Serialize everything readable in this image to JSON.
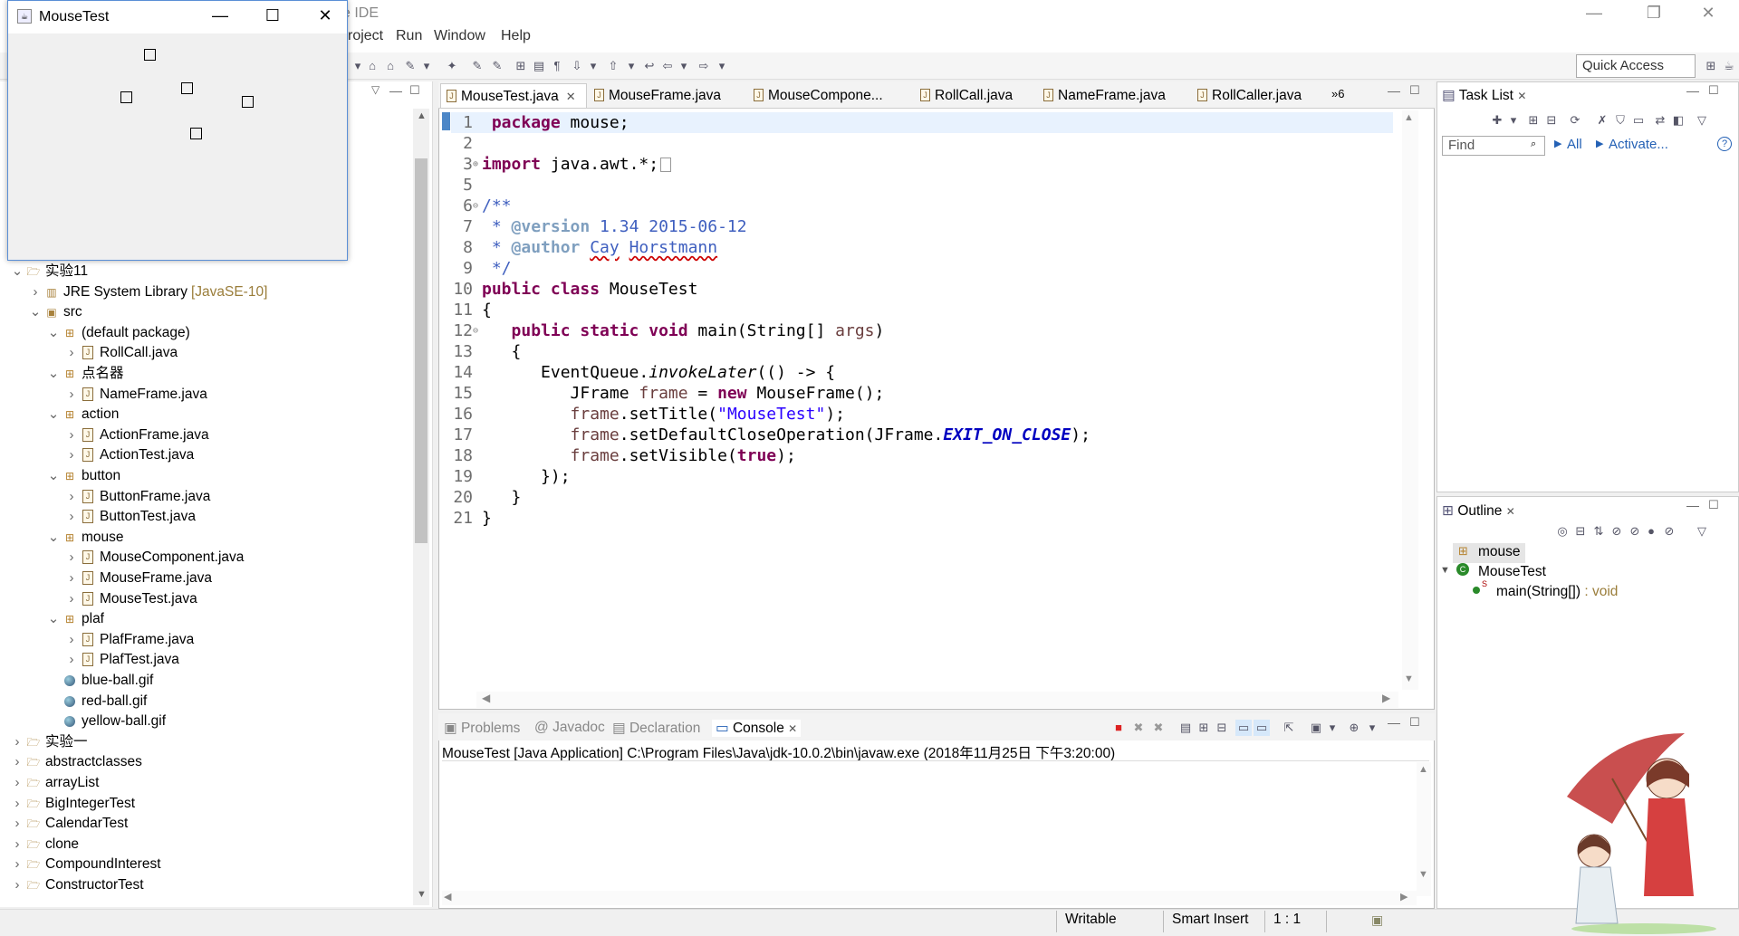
{
  "ide": {
    "title": "e IDE",
    "menus": [
      "roject",
      "Run",
      "Window",
      "Help"
    ],
    "quick_access": "Quick Access"
  },
  "mouse_window": {
    "title": "MouseTest",
    "minimize": "—",
    "maximize": "☐",
    "close": "✕"
  },
  "explorer": {
    "items": [
      {
        "label": "实验11",
        "kind": "project",
        "arrow": "v"
      },
      {
        "label": "JRE System Library",
        "suffix": "[JavaSE-10]",
        "kind": "lib",
        "arrow": ">"
      },
      {
        "label": "src",
        "kind": "folder",
        "arrow": "v"
      },
      {
        "label": "(default package)",
        "kind": "package",
        "arrow": "v"
      },
      {
        "label": "RollCall.java",
        "kind": "file",
        "arrow": ">"
      },
      {
        "label": "点名器",
        "kind": "package",
        "arrow": "v"
      },
      {
        "label": "NameFrame.java",
        "kind": "file",
        "arrow": ">"
      },
      {
        "label": "action",
        "kind": "package",
        "arrow": "v"
      },
      {
        "label": "ActionFrame.java",
        "kind": "file",
        "arrow": ">"
      },
      {
        "label": "ActionTest.java",
        "kind": "file",
        "arrow": ">"
      },
      {
        "label": "button",
        "kind": "package",
        "arrow": "v"
      },
      {
        "label": "ButtonFrame.java",
        "kind": "file",
        "arrow": ">"
      },
      {
        "label": "ButtonTest.java",
        "kind": "file",
        "arrow": ">"
      },
      {
        "label": "mouse",
        "kind": "package",
        "arrow": "v"
      },
      {
        "label": "MouseComponent.java",
        "kind": "file",
        "arrow": ">"
      },
      {
        "label": "MouseFrame.java",
        "kind": "file",
        "arrow": ">"
      },
      {
        "label": "MouseTest.java",
        "kind": "file",
        "arrow": ">"
      },
      {
        "label": "plaf",
        "kind": "package",
        "arrow": "v"
      },
      {
        "label": "PlafFrame.java",
        "kind": "file",
        "arrow": ">"
      },
      {
        "label": "PlafTest.java",
        "kind": "file",
        "arrow": ">"
      },
      {
        "label": "blue-ball.gif",
        "kind": "image",
        "arrow": ""
      },
      {
        "label": "red-ball.gif",
        "kind": "image",
        "arrow": ""
      },
      {
        "label": "yellow-ball.gif",
        "kind": "image",
        "arrow": ""
      },
      {
        "label": "实验一",
        "kind": "project",
        "arrow": ">"
      },
      {
        "label": "abstractclasses",
        "kind": "project",
        "arrow": ">"
      },
      {
        "label": "arrayList",
        "kind": "project",
        "arrow": ">"
      },
      {
        "label": "BigIntegerTest",
        "kind": "project",
        "arrow": ">"
      },
      {
        "label": "CalendarTest",
        "kind": "project",
        "arrow": ">"
      },
      {
        "label": "clone",
        "kind": "project",
        "arrow": ">"
      },
      {
        "label": "CompoundInterest",
        "kind": "project",
        "arrow": ">"
      },
      {
        "label": "ConstructorTest",
        "kind": "project",
        "arrow": ">"
      }
    ]
  },
  "editor": {
    "tabs": [
      "MouseTest.java",
      "MouseFrame.java",
      "MouseCompone...",
      "RollCall.java",
      "NameFrame.java",
      "RollCaller.java"
    ],
    "overflow": "»6",
    "line_numbers": [
      "1",
      "2",
      "3",
      "5",
      "6",
      "7",
      "8",
      "9",
      "10",
      "11",
      "12",
      "13",
      "14",
      "15",
      "16",
      "17",
      "18",
      "19",
      "20",
      "21"
    ]
  },
  "tasklist": {
    "title": "Task List",
    "find_placeholder": "Find",
    "all": "All",
    "activate": "Activate..."
  },
  "outline": {
    "title": "Outline",
    "package": "mouse",
    "class": "MouseTest",
    "method": "main(String[])",
    "method_type": " : void"
  },
  "console": {
    "tabs": [
      "Problems",
      "Javadoc",
      "Declaration",
      "Console"
    ],
    "line": "MouseTest [Java Application] C:\\Program Files\\Java\\jdk-10.0.2\\bin\\javaw.exe (2018年11月25日 下午3:20:00)"
  },
  "status": {
    "writable": "Writable",
    "insert_mode": "Smart Insert",
    "position": "1 : 1"
  }
}
